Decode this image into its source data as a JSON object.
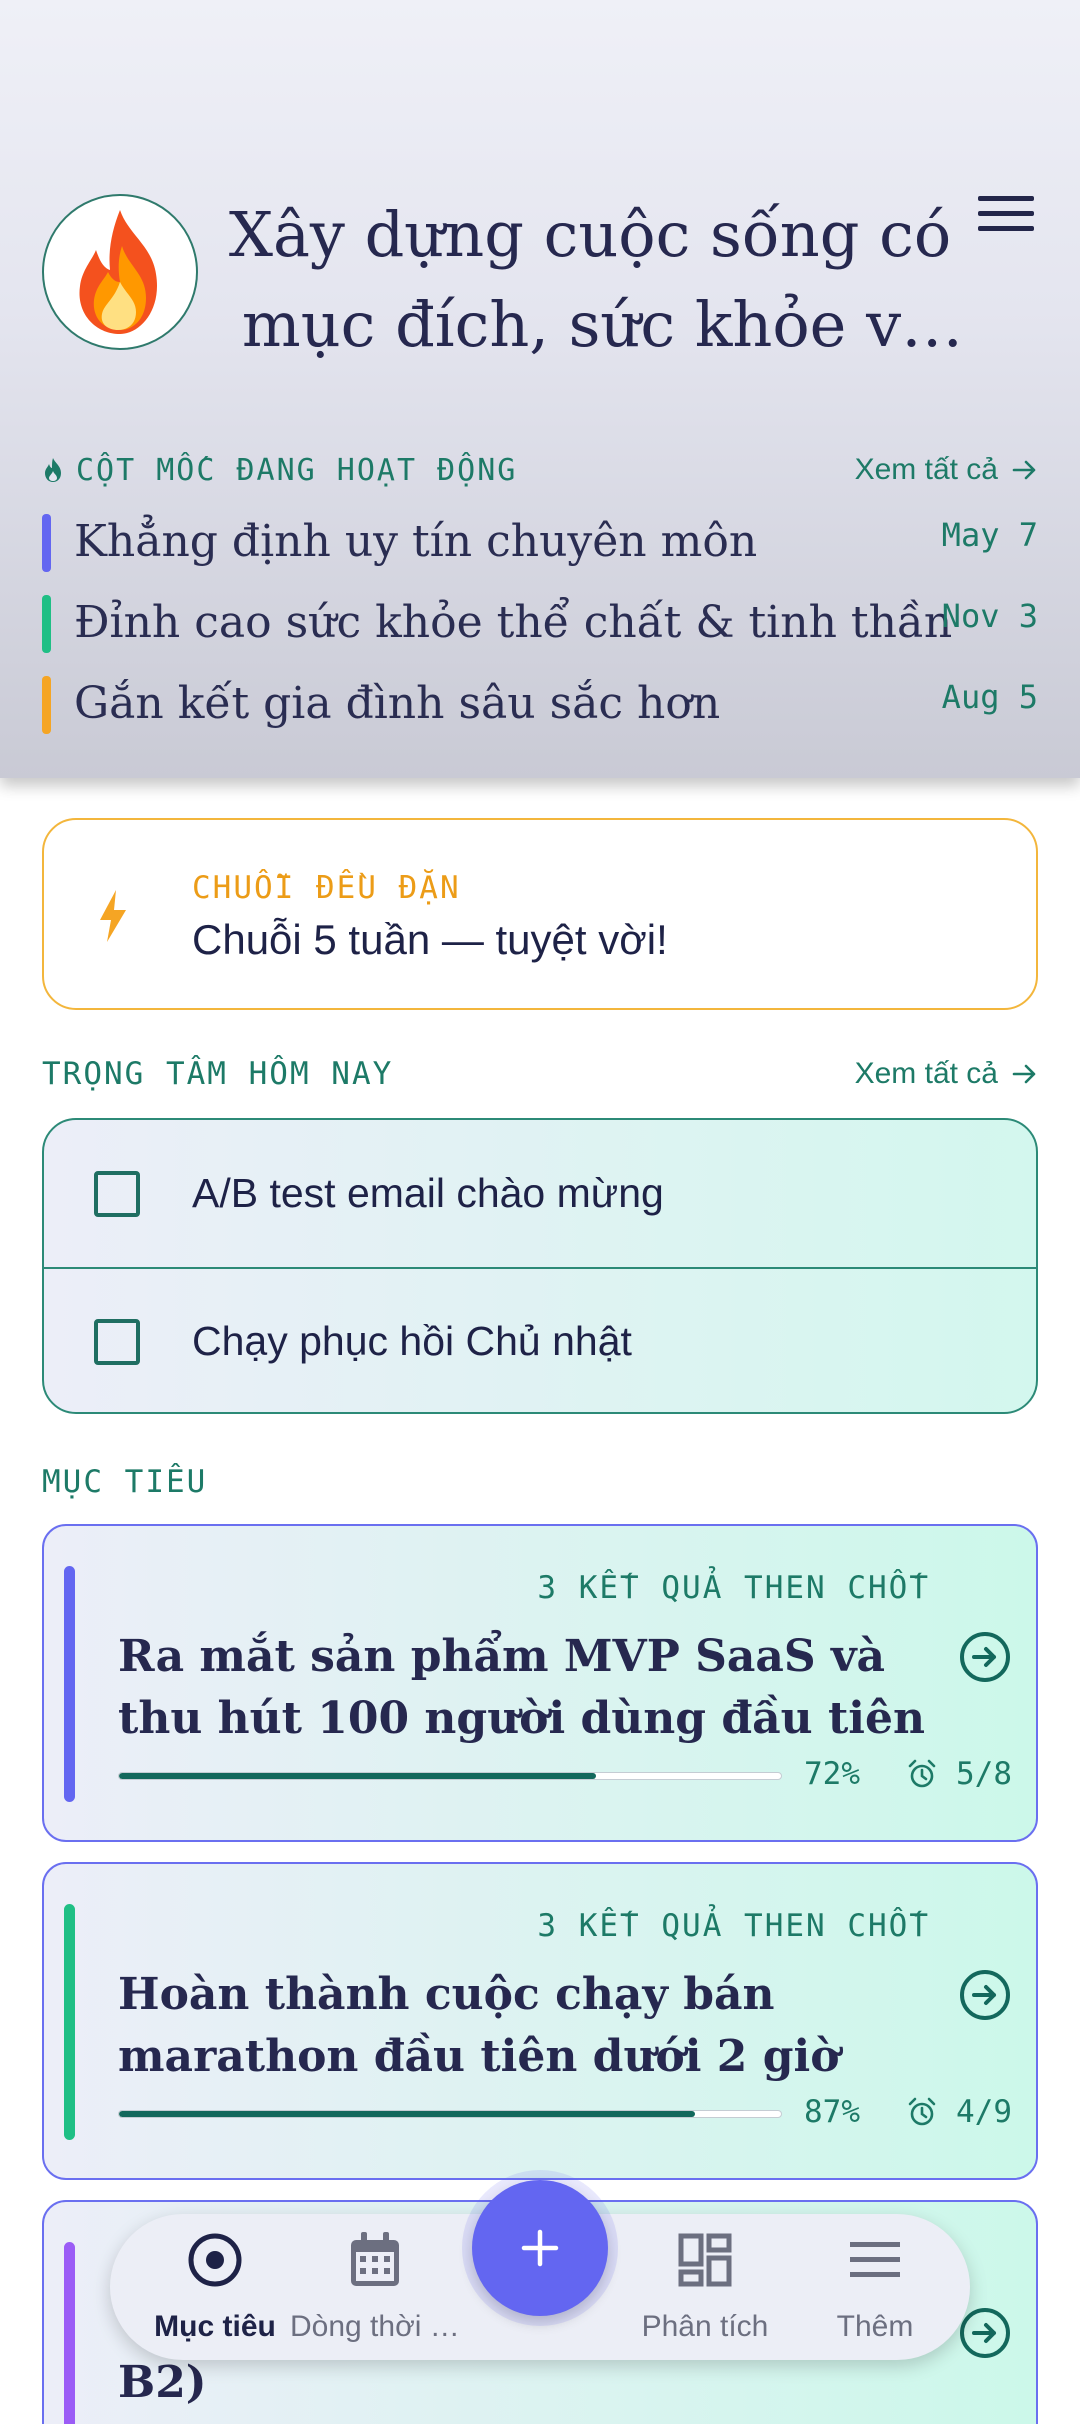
{
  "header": {
    "title": "Xây dựng cuộc sống có mục đích, sức khỏe và tình yêu",
    "avatar_icon": "fire-icon",
    "menu_icon": "hamburger-menu-icon"
  },
  "milestones": {
    "label": "CỘT MỐC ĐANG HOẠT ĐỘNG",
    "see_all": "Xem tất cả",
    "items": [
      {
        "title": "Khẳng định uy tín chuyên môn",
        "date": "May 7",
        "color": "#6366f1"
      },
      {
        "title": "Đỉnh cao sức khỏe thể chất & tinh thần",
        "date": "Nov 3",
        "color": "#1fbf85"
      },
      {
        "title": "Gắn kết gia đình sâu sắc hơn",
        "date": "Aug 5",
        "color": "#f5a524"
      }
    ]
  },
  "streak": {
    "label": "CHUỖI ĐỀU ĐẶN",
    "text": "Chuỗi 5 tuần — tuyệt vời!",
    "icon": "lightning-bolt-icon",
    "color": "#f5a524"
  },
  "focus": {
    "label": "TRỌNG TÂM HÔM NAY",
    "see_all": "Xem tất cả",
    "items": [
      {
        "text": "A/B test email chào mừng",
        "checked": false
      },
      {
        "text": "Chạy phục hồi Chủ nhật",
        "checked": false
      }
    ]
  },
  "goals": {
    "label": "MỤC TIÊU",
    "items": [
      {
        "kr": "3 KẾT QUẢ THEN CHỐT",
        "title": "Ra mắt sản phẩm MVP SaaS và thu hút 100 người dùng đầu tiên",
        "progress": 0.72,
        "pct": "72%",
        "count": "5/8",
        "color": "#6366f1"
      },
      {
        "kr": "3 KẾT QUẢ THEN CHỐT",
        "title": "Hoàn thành cuộc chạy bán marathon đầu tiên dưới 2 giờ",
        "progress": 0.87,
        "pct": "87%",
        "count": "4/9",
        "color": "#1fbf85"
      },
      {
        "kr": "",
        "title": "B2)",
        "color": "#9b5cf6"
      }
    ]
  },
  "nav": {
    "items": [
      {
        "label": "Mục tiêu",
        "icon": "target-icon",
        "active": true
      },
      {
        "label": "Dòng thời gian",
        "icon": "calendar-icon",
        "active": false
      },
      {
        "label": "Phân tích",
        "icon": "dashboard-grid-icon",
        "active": false
      },
      {
        "label": "Thêm",
        "icon": "menu-icon",
        "active": false
      }
    ],
    "fab_icon": "plus-icon",
    "accent": "#6366f1"
  }
}
